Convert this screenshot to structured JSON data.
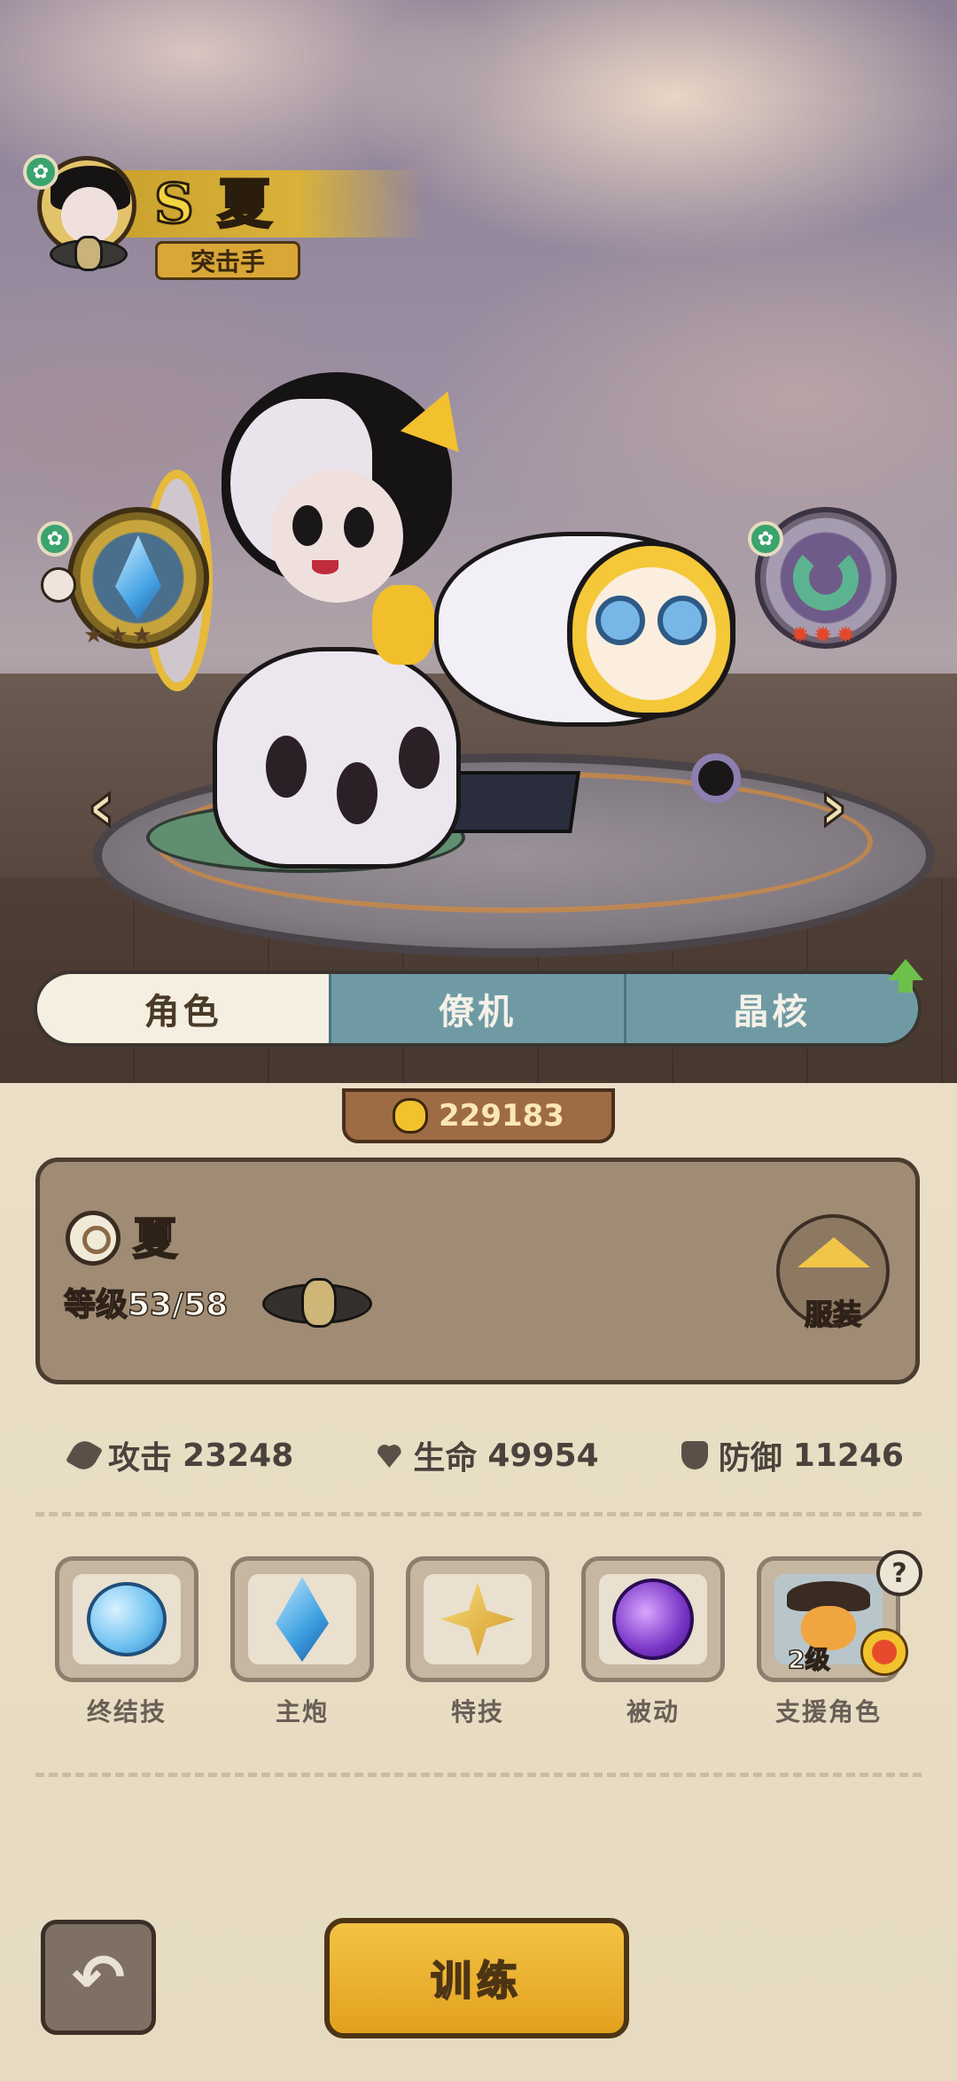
{
  "header": {
    "grade": "S",
    "character_name": "夏",
    "role": "突击手",
    "element_badge": "leaf-element-icon"
  },
  "gear": {
    "left_slot": {
      "icon": "crystal-icon",
      "stars": [
        "★",
        "★",
        "★"
      ]
    },
    "right_slot": {
      "icon": "horseshoe-magnet-icon",
      "stars": [
        "✹",
        "✹",
        "✹"
      ]
    }
  },
  "navigation": {
    "prev_arrow": "‹",
    "next_arrow": "›"
  },
  "tabs": [
    {
      "label": "角色",
      "active": true
    },
    {
      "label": "僚机",
      "active": false
    },
    {
      "label": "晶核",
      "active": false
    }
  ],
  "power": {
    "value": "229183"
  },
  "card": {
    "name": "夏",
    "level": "等级53/58",
    "outfit_label": "服装"
  },
  "stats": [
    {
      "label": "攻击",
      "value": "23248",
      "icon": "attack-icon"
    },
    {
      "label": "生命",
      "value": "49954",
      "icon": "health-heart-icon"
    },
    {
      "label": "防御",
      "value": "11246",
      "icon": "defense-shield-icon"
    }
  ],
  "skills": [
    {
      "label": "终结技",
      "icon": "ice-apple-icon"
    },
    {
      "label": "主炮",
      "icon": "blue-gem-icon"
    },
    {
      "label": "特技",
      "icon": "gold-star-icon"
    },
    {
      "label": "被动",
      "icon": "purple-orb-icon"
    },
    {
      "label": "支援角色",
      "icon": "support-character-icon",
      "level": "2级",
      "help": "?"
    }
  ],
  "footer": {
    "back_glyph": "↶",
    "train_label": "训练"
  },
  "colors": {
    "accent_gold": "#e2a11d",
    "tab_inactive": "#6f9aa4",
    "panel_bg": "#eadfc6"
  }
}
